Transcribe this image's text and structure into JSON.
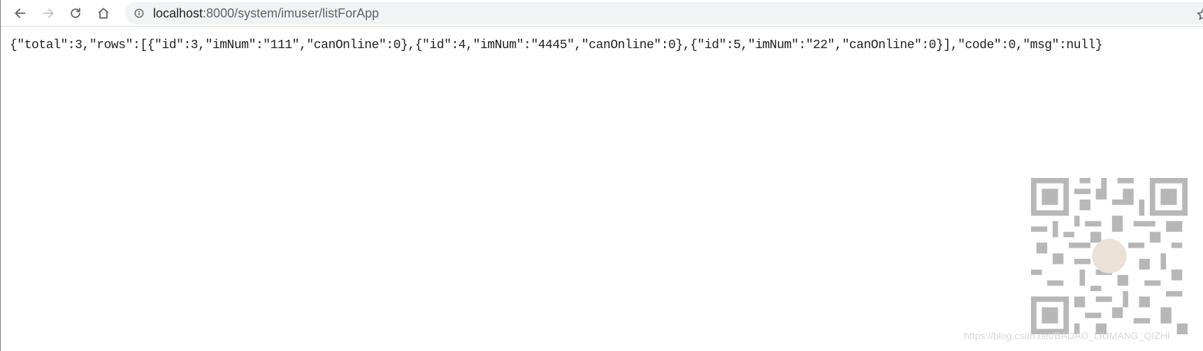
{
  "browser": {
    "url_host": "localhost",
    "url_path": ":8000/system/imuser/listForApp",
    "icons": {
      "back": "back-arrow-icon",
      "forward": "forward-arrow-icon",
      "reload": "reload-icon",
      "home": "home-icon",
      "info": "info-icon",
      "bookmark": "star-icon"
    }
  },
  "page": {
    "json_text": "{\"total\":3,\"rows\":[{\"id\":3,\"imNum\":\"111\",\"canOnline\":0},{\"id\":4,\"imNum\":\"4445\",\"canOnline\":0},{\"id\":5,\"imNum\":\"22\",\"canOnline\":0}],\"code\":0,\"msg\":null}",
    "watermark": "https://blog.csdn.net/BADAO_LIUMANG_QIZHI"
  },
  "colors": {
    "accent": "#5f6368",
    "omnibox_bg": "#f1f3f4",
    "text": "#202124"
  }
}
